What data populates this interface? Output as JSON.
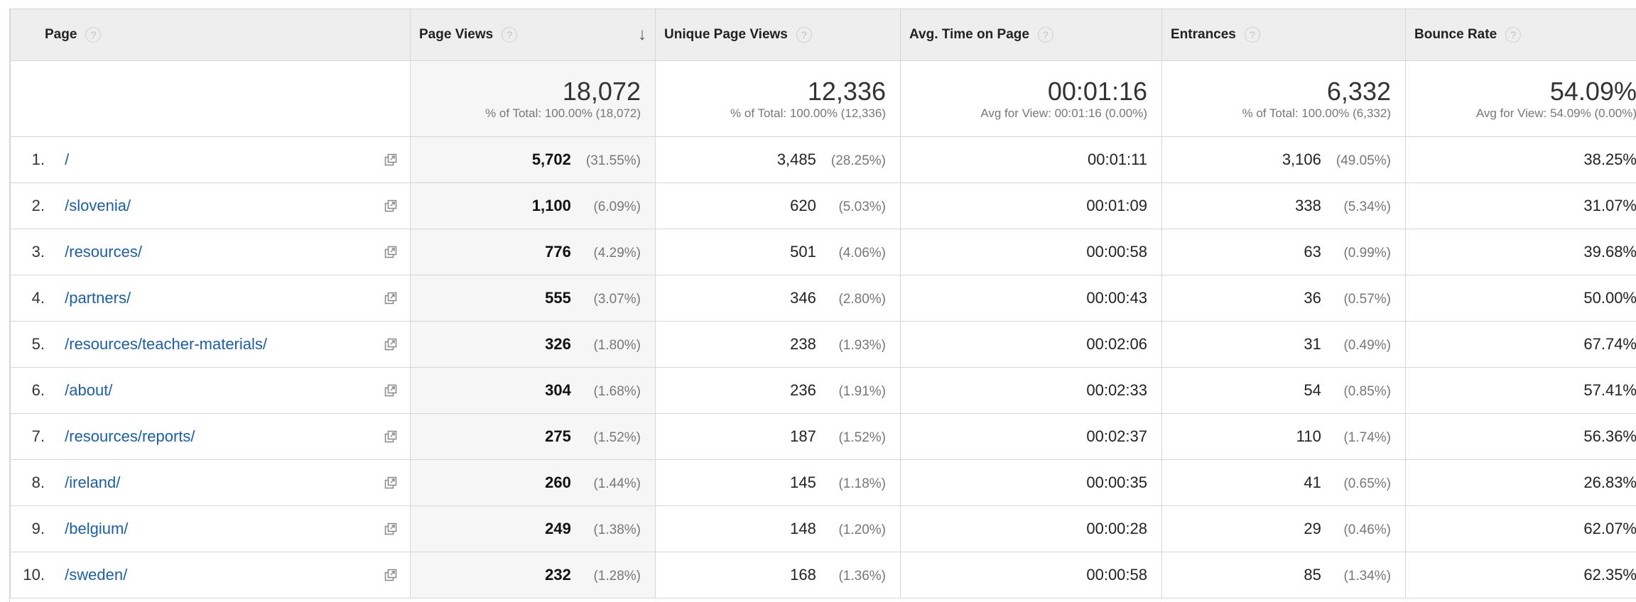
{
  "headers": {
    "page": "Page",
    "page_views": "Page Views",
    "unique_page_views": "Unique Page Views",
    "avg_time": "Avg. Time on Page",
    "entrances": "Entrances",
    "bounce_rate": "Bounce Rate",
    "help": "?",
    "sort": "↓"
  },
  "totals": {
    "page_views": {
      "value": "18,072",
      "sub": "% of Total: 100.00% (18,072)"
    },
    "unique_page_views": {
      "value": "12,336",
      "sub": "% of Total: 100.00% (12,336)"
    },
    "avg_time": {
      "value": "00:01:16",
      "sub": "Avg for View: 00:01:16 (0.00%)"
    },
    "entrances": {
      "value": "6,332",
      "sub": "% of Total: 100.00% (6,332)"
    },
    "bounce_rate": {
      "value": "54.09%",
      "sub": "Avg for View: 54.09% (0.00%)"
    }
  },
  "rows": [
    {
      "rank": "1.",
      "page": "/",
      "pv": "5,702",
      "pv_pct": "(31.55%)",
      "upv": "3,485",
      "upv_pct": "(28.25%)",
      "avg": "00:01:11",
      "ent": "3,106",
      "ent_pct": "(49.05%)",
      "br": "38.25%"
    },
    {
      "rank": "2.",
      "page": "/slovenia/",
      "pv": "1,100",
      "pv_pct": "(6.09%)",
      "upv": "620",
      "upv_pct": "(5.03%)",
      "avg": "00:01:09",
      "ent": "338",
      "ent_pct": "(5.34%)",
      "br": "31.07%"
    },
    {
      "rank": "3.",
      "page": "/resources/",
      "pv": "776",
      "pv_pct": "(4.29%)",
      "upv": "501",
      "upv_pct": "(4.06%)",
      "avg": "00:00:58",
      "ent": "63",
      "ent_pct": "(0.99%)",
      "br": "39.68%"
    },
    {
      "rank": "4.",
      "page": "/partners/",
      "pv": "555",
      "pv_pct": "(3.07%)",
      "upv": "346",
      "upv_pct": "(2.80%)",
      "avg": "00:00:43",
      "ent": "36",
      "ent_pct": "(0.57%)",
      "br": "50.00%"
    },
    {
      "rank": "5.",
      "page": "/resources/teacher-materials/",
      "pv": "326",
      "pv_pct": "(1.80%)",
      "upv": "238",
      "upv_pct": "(1.93%)",
      "avg": "00:02:06",
      "ent": "31",
      "ent_pct": "(0.49%)",
      "br": "67.74%"
    },
    {
      "rank": "6.",
      "page": "/about/",
      "pv": "304",
      "pv_pct": "(1.68%)",
      "upv": "236",
      "upv_pct": "(1.91%)",
      "avg": "00:02:33",
      "ent": "54",
      "ent_pct": "(0.85%)",
      "br": "57.41%"
    },
    {
      "rank": "7.",
      "page": "/resources/reports/",
      "pv": "275",
      "pv_pct": "(1.52%)",
      "upv": "187",
      "upv_pct": "(1.52%)",
      "avg": "00:02:37",
      "ent": "110",
      "ent_pct": "(1.74%)",
      "br": "56.36%"
    },
    {
      "rank": "8.",
      "page": "/ireland/",
      "pv": "260",
      "pv_pct": "(1.44%)",
      "upv": "145",
      "upv_pct": "(1.18%)",
      "avg": "00:00:35",
      "ent": "41",
      "ent_pct": "(0.65%)",
      "br": "26.83%"
    },
    {
      "rank": "9.",
      "page": "/belgium/",
      "pv": "249",
      "pv_pct": "(1.38%)",
      "upv": "148",
      "upv_pct": "(1.20%)",
      "avg": "00:00:28",
      "ent": "29",
      "ent_pct": "(0.46%)",
      "br": "62.07%"
    },
    {
      "rank": "10.",
      "page": "/sweden/",
      "pv": "232",
      "pv_pct": "(1.28%)",
      "upv": "168",
      "upv_pct": "(1.36%)",
      "avg": "00:00:58",
      "ent": "85",
      "ent_pct": "(1.34%)",
      "br": "62.35%"
    }
  ],
  "colors": {
    "link": "#1a5fa8",
    "header_bg": "#eeeeee",
    "sorted_col_bg": "#f6f6f6",
    "border": "#d6d6d6"
  },
  "icons": {
    "help": "help-icon",
    "sort": "sort-descending-icon",
    "row_action": "open-in-new-window-icon"
  }
}
